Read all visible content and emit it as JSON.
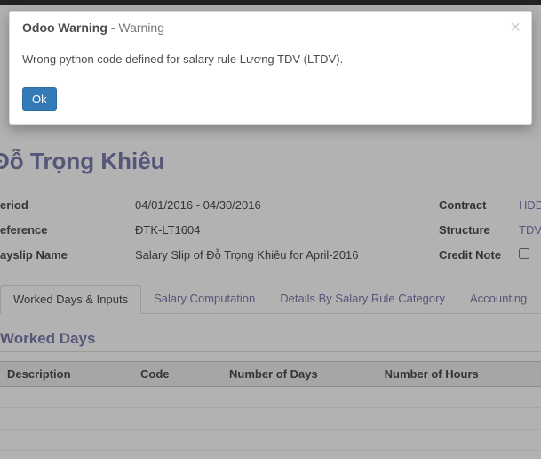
{
  "modal": {
    "title_bold": "Odoo Warning",
    "title_sep": " - ",
    "title_light": "Warning",
    "message": "Wrong python code defined for salary rule Lương TDV (LTDV).",
    "ok": "Ok",
    "close": "×"
  },
  "page": {
    "title": "Đỗ Trọng Khiêu",
    "left_labels": {
      "period": "eriod",
      "reference": "eference",
      "payslip_name": "ayslip Name"
    },
    "values": {
      "period_from": "04/01/2016",
      "period_sep": " - ",
      "period_to": "04/30/2016",
      "reference": "ĐTK-LT1604",
      "payslip_name": "Salary Slip of Đỗ Trọng Khiêu for April-2016"
    },
    "right_labels": {
      "contract": "Contract",
      "structure": "Structure",
      "credit_note": "Credit Note"
    },
    "right_values": {
      "contract": "HDDTK",
      "structure": "TDV k"
    },
    "tabs": {
      "worked": "Worked Days & Inputs",
      "salary_comp": "Salary Computation",
      "details": "Details By Salary Rule Category",
      "accounting": "Accounting"
    },
    "section_worked": "Worked Days",
    "table_headers": {
      "description": "Description",
      "code": "Code",
      "num_days": "Number of Days",
      "num_hours": "Number of Hours"
    }
  }
}
